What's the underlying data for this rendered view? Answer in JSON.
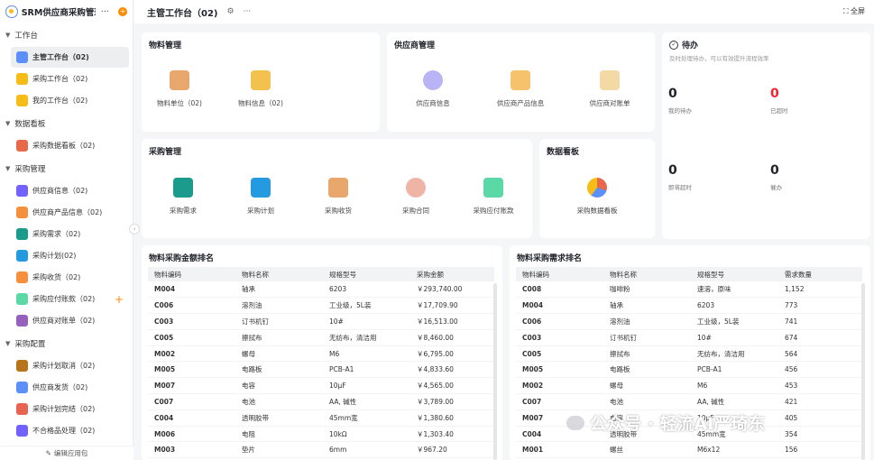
{
  "sidebar": {
    "app_title": "SRM供应商采购管理",
    "more": "···",
    "badge": "+",
    "footer": "编辑应用包",
    "groups": [
      {
        "title": "工作台",
        "items": [
          {
            "label": "主管工作台（02)",
            "icon": "dashboard-icon",
            "color": "#5b8ff9"
          },
          {
            "label": "采购工作台（02)",
            "icon": "workflow-icon",
            "color": "#f6bd16"
          },
          {
            "label": "我的工作台（02)",
            "icon": "workflow-icon",
            "color": "#f6bd16"
          }
        ]
      },
      {
        "title": "数据看板",
        "items": [
          {
            "label": "采购数据看板（02)",
            "icon": "pie-chart-icon",
            "color": "#e8684a"
          }
        ]
      },
      {
        "title": "采购管理",
        "items": [
          {
            "label": "供应商信息（02)",
            "icon": "supplier-search-icon",
            "color": "#7262fd"
          },
          {
            "label": "供应商产品信息（02)",
            "icon": "book-icon",
            "color": "#f6903d"
          },
          {
            "label": "采购需求（02)",
            "icon": "chat-icon",
            "color": "#1a9b8c"
          },
          {
            "label": "采购计划(02)",
            "icon": "cart-monitor-icon",
            "color": "#269ae0"
          },
          {
            "label": "采购收货（02)",
            "icon": "clipboard-icon",
            "color": "#f6903d"
          },
          {
            "label": "采购应付账款（02)",
            "icon": "calculator-icon",
            "color": "#5ad8a6"
          },
          {
            "label": "供应商对账单（02)",
            "icon": "ledger-icon",
            "color": "#9661bc"
          }
        ]
      },
      {
        "title": "采购配置",
        "items": [
          {
            "label": "采购计划取消（02)",
            "icon": "person-icon",
            "color": "#b8741a"
          },
          {
            "label": "供应商发货（02)",
            "icon": "truck-icon",
            "color": "#5b8ff9"
          },
          {
            "label": "采购计划完结（02)",
            "icon": "list-check-icon",
            "color": "#e86452"
          },
          {
            "label": "不合格品处理（02)",
            "icon": "target-icon",
            "color": "#7262fd"
          }
        ]
      }
    ]
  },
  "header": {
    "title": "主管工作台（02)",
    "fullscreen": "全屏",
    "more": "···"
  },
  "material": {
    "title": "物料管理",
    "tiles": [
      "物料单位（02)",
      "物料信息（02)"
    ]
  },
  "supplier": {
    "title": "供应商管理",
    "tiles": [
      "供应商信息",
      "供应商产品信息",
      "供应商对账单"
    ]
  },
  "todo": {
    "title": "待办",
    "subtitle": "及时处理待办，可以有效提升流程效率",
    "stats": [
      {
        "value": "0",
        "label": "我的待办",
        "color": "#1f2329"
      },
      {
        "value": "0",
        "label": "已超时",
        "color": "#f5222d"
      },
      {
        "value": "0",
        "label": "即将超时",
        "color": "#1f2329"
      },
      {
        "value": "0",
        "label": "催办",
        "color": "#1f2329"
      }
    ]
  },
  "purchase": {
    "title": "采购管理",
    "tiles": [
      "采购需求",
      "采购计划",
      "采购收货",
      "采购合同",
      "采购应付账款"
    ]
  },
  "board": {
    "title": "数据看板",
    "tiles": [
      "采购数据看板"
    ]
  },
  "amount_rank": {
    "title": "物料采购金额排名",
    "columns": [
      "物料编码",
      "物料名称",
      "规格型号",
      "采购金额"
    ],
    "rows": [
      [
        "M004",
        "轴承",
        "6203",
        "￥293,740.00"
      ],
      [
        "C006",
        "溶剂油",
        "工业级，5L装",
        "￥17,709.90"
      ],
      [
        "C003",
        "订书机钉",
        "10#",
        "￥16,513.00"
      ],
      [
        "C005",
        "擦拭布",
        "无纺布，清洁用",
        "￥8,460.00"
      ],
      [
        "M002",
        "螺母",
        "M6",
        "￥6,795.00"
      ],
      [
        "M005",
        "电路板",
        "PCB-A1",
        "￥4,833.60"
      ],
      [
        "M007",
        "电容",
        "10μF",
        "￥4,565.00"
      ],
      [
        "C007",
        "电池",
        "AA, 碱性",
        "￥3,789.00"
      ],
      [
        "C004",
        "透明胶带",
        "45mm宽",
        "￥1,380.60"
      ],
      [
        "M006",
        "电阻",
        "10kΩ",
        "￥1,303.40"
      ],
      [
        "M003",
        "垫片",
        "6mm",
        "￥967.20"
      ]
    ]
  },
  "demand_rank": {
    "title": "物料采购需求排名",
    "columns": [
      "物料编码",
      "物料名称",
      "规格型号",
      "需求数量"
    ],
    "rows": [
      [
        "C008",
        "咖啡粉",
        "速溶，原味",
        "1,152"
      ],
      [
        "M004",
        "轴承",
        "6203",
        "773"
      ],
      [
        "C006",
        "溶剂油",
        "工业级，5L装",
        "741"
      ],
      [
        "C003",
        "订书机钉",
        "10#",
        "674"
      ],
      [
        "C005",
        "擦拭布",
        "无纺布，清洁用",
        "564"
      ],
      [
        "M005",
        "电路板",
        "PCB-A1",
        "456"
      ],
      [
        "M002",
        "螺母",
        "M6",
        "453"
      ],
      [
        "C007",
        "电池",
        "AA, 碱性",
        "421"
      ],
      [
        "M007",
        "电容",
        "10μF",
        "405"
      ],
      [
        "C004",
        "透明胶带",
        "45mm宽",
        "354"
      ],
      [
        "M001",
        "螺丝",
        "M6x12",
        "156"
      ]
    ]
  },
  "watermark": "公众号 · 轻流AI严琦东"
}
